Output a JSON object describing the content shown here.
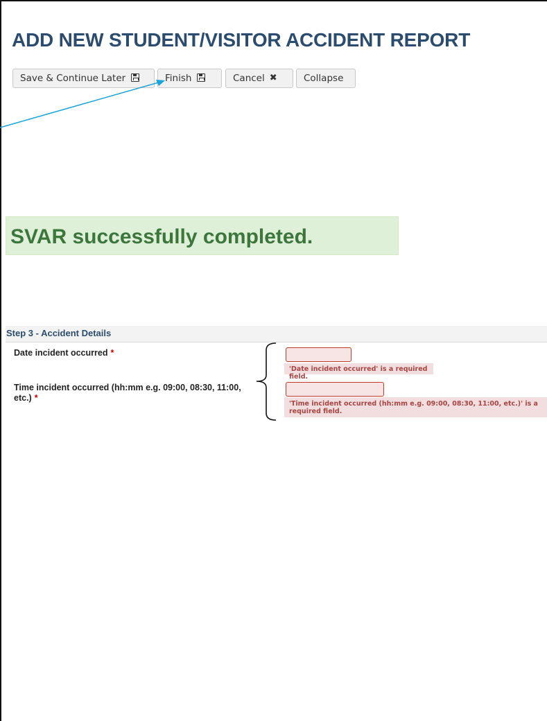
{
  "page": {
    "title": "ADD NEW STUDENT/VISITOR ACCIDENT REPORT"
  },
  "toolbar": {
    "save_continue_label": "Save & Continue Later",
    "finish_label": "Finish",
    "cancel_label": "Cancel",
    "collapse_label": "Collapse"
  },
  "success": {
    "message": "SVAR successfully completed."
  },
  "step": {
    "header": "Step 3 - Accident Details",
    "fields": [
      {
        "label": "Date incident occurred",
        "required_mark": "*",
        "value": "",
        "error": "'Date incident occurred' is a required field."
      },
      {
        "label": "Time incident occurred (hh:mm e.g. 09:00, 08:30, 11:00, etc.)",
        "required_mark": "*",
        "value": "",
        "error": "'Time incident occurred (hh:mm e.g. 09:00, 08:30, 11:00, etc.)' is a required field."
      }
    ]
  },
  "colors": {
    "title": "#2b4c6e",
    "success_bg": "#dff0d8",
    "success_text": "#3c763d",
    "error_bg": "#f2dede",
    "error_border": "#c0392b",
    "required": "#cc0000",
    "arrow": "#1aa3d9"
  },
  "icons": {
    "save": "floppy-disk-icon",
    "cancel": "close-x-icon"
  }
}
